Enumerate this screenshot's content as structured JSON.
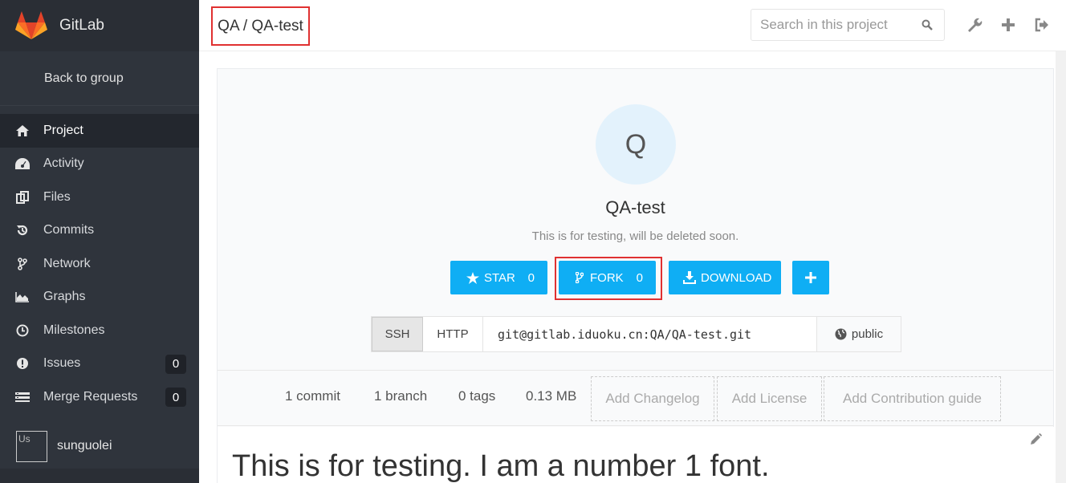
{
  "app": {
    "name": "GitLab"
  },
  "sidebar": {
    "back_label": "Back to group",
    "items": [
      {
        "label": "Project",
        "icon": "home-icon",
        "active": true
      },
      {
        "label": "Activity",
        "icon": "dashboard-icon"
      },
      {
        "label": "Files",
        "icon": "files-icon"
      },
      {
        "label": "Commits",
        "icon": "history-icon"
      },
      {
        "label": "Network",
        "icon": "code-fork-icon"
      },
      {
        "label": "Graphs",
        "icon": "area-chart-icon"
      },
      {
        "label": "Milestones",
        "icon": "clock-icon"
      },
      {
        "label": "Issues",
        "icon": "exclamation-circle-icon",
        "badge": "0"
      },
      {
        "label": "Merge Requests",
        "icon": "list-icon",
        "badge": "0"
      }
    ],
    "user": {
      "name": "sunguolei",
      "avatar_alt": "Us"
    }
  },
  "header": {
    "breadcrumb": "QA / QA-test",
    "search_placeholder": "Search in this project"
  },
  "project": {
    "avatar_letter": "Q",
    "name": "QA-test",
    "description": "This is for testing, will be deleted soon.",
    "star_label": "STAR",
    "star_count": "0",
    "fork_label": "FORK",
    "fork_count": "0",
    "download_label": "DOWNLOAD",
    "clone": {
      "ssh_label": "SSH",
      "http_label": "HTTP",
      "url": "git@gitlab.iduoku.cn:QA/QA-test.git",
      "visibility": "public"
    },
    "stats": {
      "commits": "1 commit",
      "branches": "1 branch",
      "tags": "0 tags",
      "size": "0.13 MB",
      "add_changelog": "Add Changelog",
      "add_license": "Add License",
      "add_contribution": "Add Contribution guide"
    },
    "readme_heading": "This is for testing. I am a number 1 font."
  },
  "colors": {
    "accent": "#0faef4",
    "sidebar": "#2f343c",
    "highlight": "#e03131"
  }
}
